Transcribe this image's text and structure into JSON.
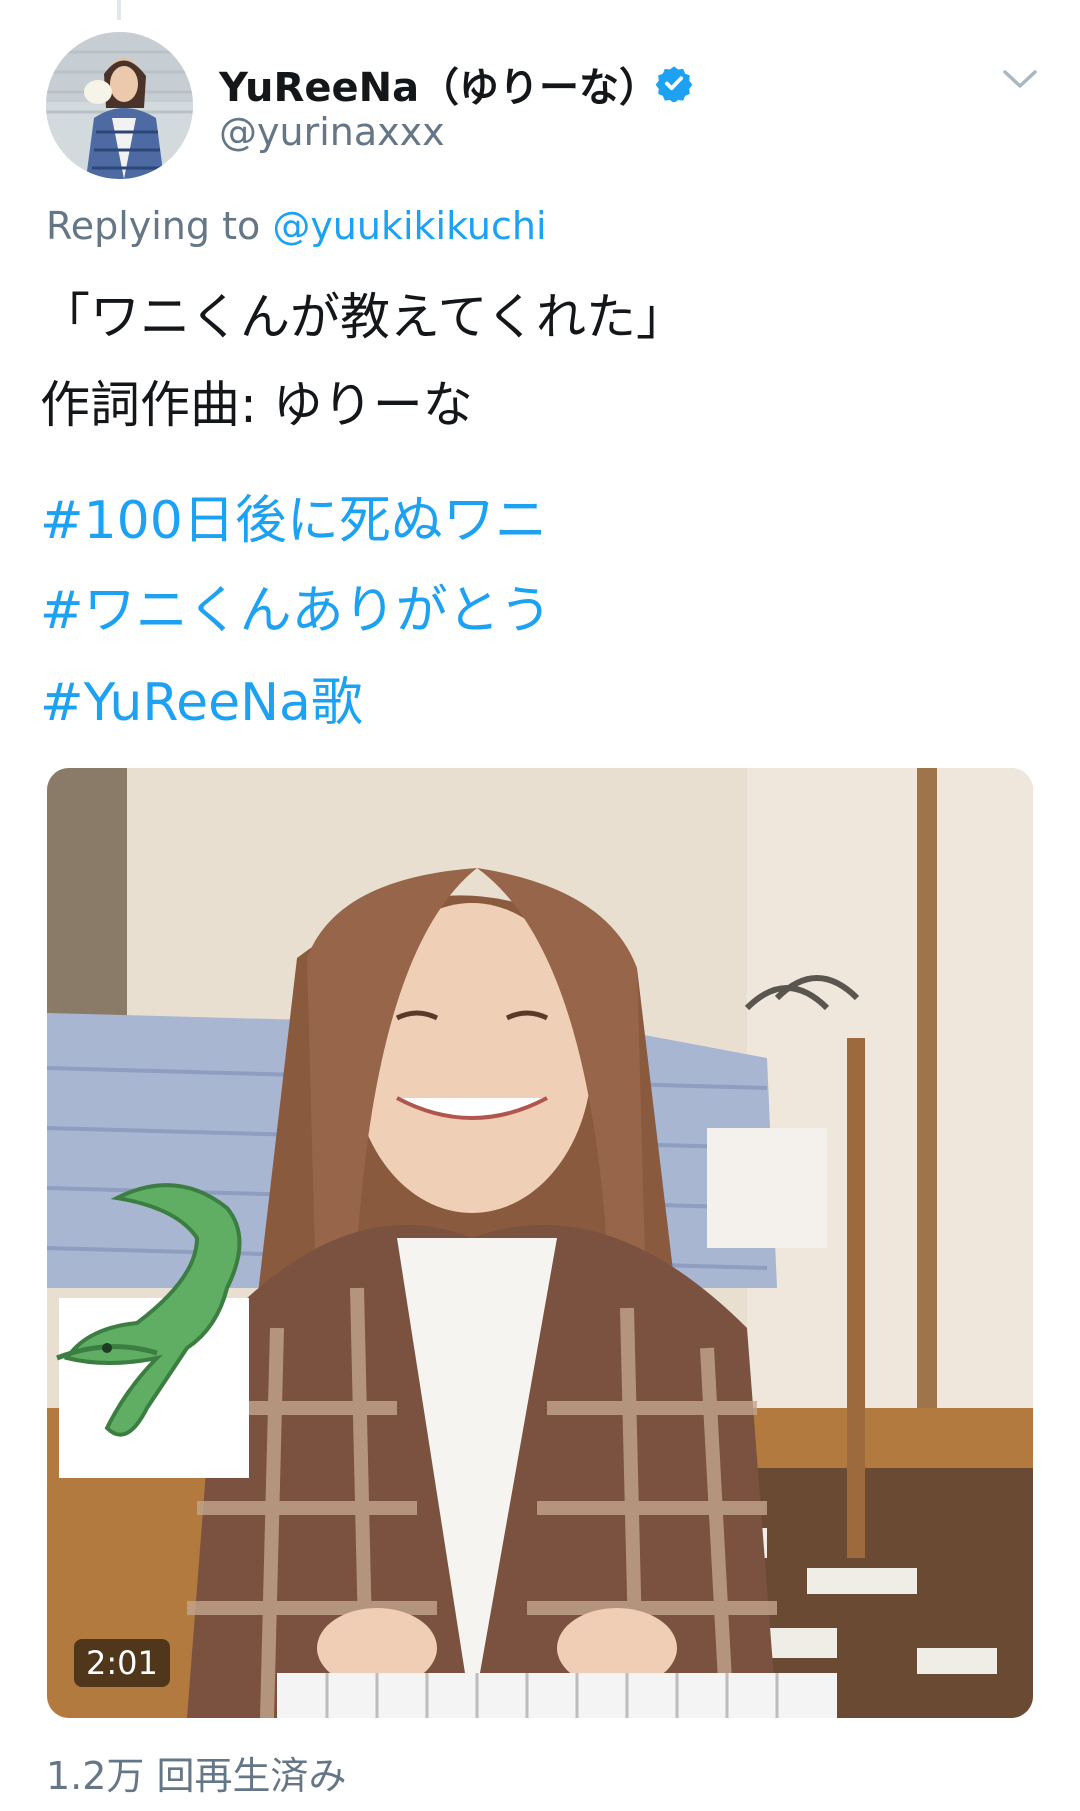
{
  "tweet": {
    "display_name": "YuReeNa（ゆりーな）",
    "handle": "@yurinaxxx",
    "reply_prefix": "Replying to ",
    "reply_mention": "@yuukikikuchi",
    "text_lines": [
      "「ワニくんが教えてくれた」",
      "作詞作曲: ゆりーな"
    ],
    "hashtags": [
      "#100日後に死ぬワニ",
      "#ワニくんありがとう",
      "#YuReeNa歌"
    ],
    "video": {
      "duration": "2:01",
      "views": "1.2万 回再生済み"
    }
  },
  "icons": {
    "verified": "verified-badge-icon",
    "menu": "chevron-down-icon"
  },
  "colors": {
    "link": "#1da1f2",
    "secondary_text": "#657786",
    "primary_text": "#14171a"
  }
}
